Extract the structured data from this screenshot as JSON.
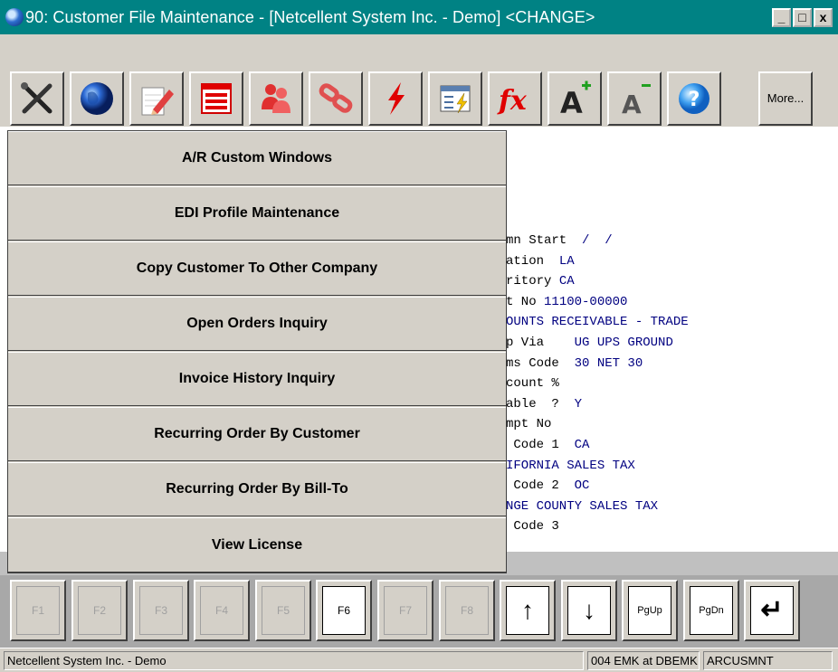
{
  "window": {
    "title": "90: Customer File Maintenance - [Netcellent System Inc. - Demo] <CHANGE>",
    "buttons": {
      "minimize": "_",
      "maximize": "□",
      "close": "x"
    }
  },
  "toolbar": {
    "buttons": [
      {
        "name": "exit",
        "icon": "tools-x-icon"
      },
      {
        "name": "internet",
        "icon": "globe-icon"
      },
      {
        "name": "notes",
        "icon": "notepad-pencil-icon"
      },
      {
        "name": "form",
        "icon": "form-list-icon"
      },
      {
        "name": "contacts",
        "icon": "people-icon"
      },
      {
        "name": "links",
        "icon": "chain-link-icon"
      },
      {
        "name": "quick",
        "icon": "lightning-icon"
      },
      {
        "name": "report",
        "icon": "report-lightning-icon"
      },
      {
        "name": "function",
        "icon": "fx-icon"
      },
      {
        "name": "font-increase",
        "icon": "font-plus-icon"
      },
      {
        "name": "font-decrease",
        "icon": "font-minus-icon"
      },
      {
        "name": "help",
        "icon": "help-icon"
      }
    ],
    "more_label": "More..."
  },
  "menu": {
    "items": [
      "A/R Custom Windows",
      "EDI Profile Maintenance",
      "Copy Customer To Other Company",
      "Open Orders Inquiry",
      "Invoice History Inquiry",
      "Recurring Order By Customer",
      "Recurring Order By Bill-To",
      "View License"
    ]
  },
  "background_form": {
    "lines": [
      {
        "label": "mn Start",
        "value": "  /  /"
      },
      {
        "label": "ation",
        "value": "  LA"
      },
      {
        "label": "ritory",
        "value": " CA"
      },
      {
        "label": "t No ",
        "value": "11100-00000"
      },
      {
        "label": "",
        "value": "OUNTS RECEIVABLE - TRADE"
      },
      {
        "label": "p Via",
        "value": "    UG UPS GROUND"
      },
      {
        "label": "ms Code",
        "value": "  30 NET 30"
      },
      {
        "label": "count %",
        "value": ""
      },
      {
        "label": "able  ?",
        "value": "  Y"
      },
      {
        "label": "mpt No",
        "value": ""
      },
      {
        "label": " Code 1",
        "value": "  CA"
      },
      {
        "label": "",
        "value": "IFORNIA SALES TAX"
      },
      {
        "label": " Code 2",
        "value": "  OC"
      },
      {
        "label": "",
        "value": "NGE COUNTY SALES TAX"
      },
      {
        "label": " Code 3",
        "value": ""
      }
    ]
  },
  "function_keys": [
    "F1",
    "F2",
    "F3",
    "F4",
    "F5",
    "F6",
    "F7",
    "F8"
  ],
  "active_function_key": "F6",
  "nav_keys": {
    "up": "↑",
    "down": "↓",
    "pgup": "PgUp",
    "pgdn": "PgDn",
    "enter": "↵"
  },
  "status": {
    "company": "Netcellent System Inc. - Demo",
    "user": "004 EMK at DBEMK",
    "program": "ARCUSMNT"
  }
}
